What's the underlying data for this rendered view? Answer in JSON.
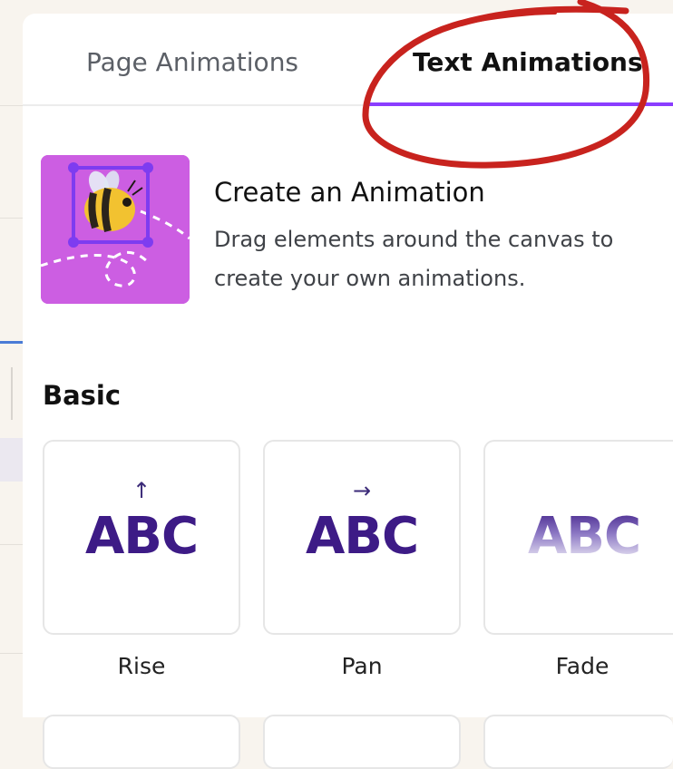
{
  "tabs": [
    {
      "label": "Page Animations",
      "active": false
    },
    {
      "label": "Text Animations",
      "active": true
    }
  ],
  "create_animation": {
    "title": "Create an Animation",
    "description": "Drag elements around the canvas to create your own animations.",
    "thumbnail_icon": "bee-icon"
  },
  "section": {
    "title": "Basic"
  },
  "animations": [
    {
      "label": "Rise",
      "preview_text": "ABC",
      "arrow": "↑"
    },
    {
      "label": "Pan",
      "preview_text": "ABC",
      "arrow": "→"
    },
    {
      "label": "Fade",
      "preview_text": "ABC",
      "arrow": ""
    }
  ],
  "colors": {
    "accent": "#8b3dff",
    "preview_text": "#3d1b86",
    "thumbnail_bg": "#cc5ee2",
    "annotation": "#c8231e"
  }
}
